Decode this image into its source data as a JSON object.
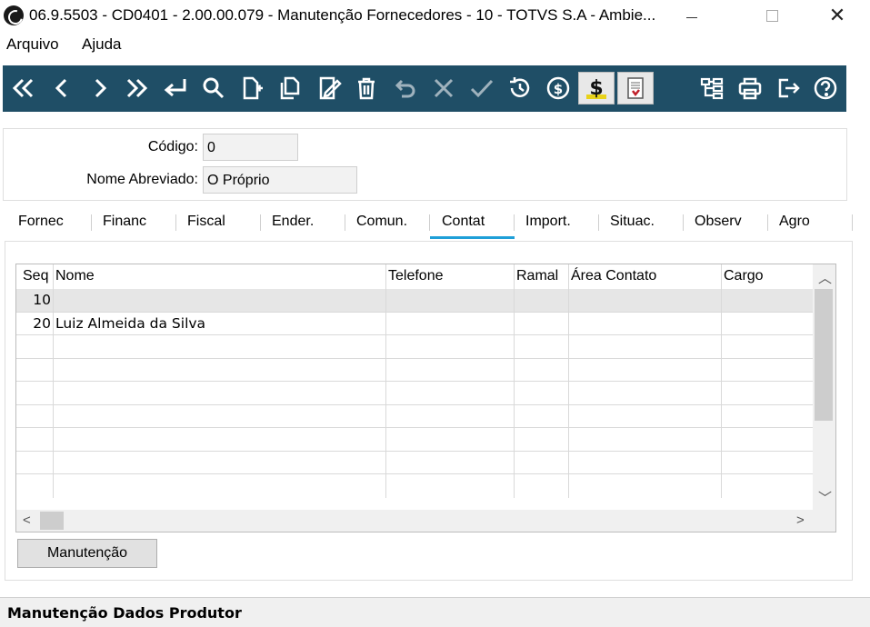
{
  "window": {
    "title": "06.9.5503 - CD0401 - 2.00.00.079 - Manutenção Fornecedores - 10 - TOTVS S.A - Ambie..."
  },
  "menu": {
    "items": [
      "Arquivo",
      "Ajuda"
    ]
  },
  "toolbar": {
    "color": "#1f4e66",
    "buttons": [
      {
        "icon": "first-record-icon"
      },
      {
        "icon": "previous-record-icon"
      },
      {
        "icon": "next-record-icon"
      },
      {
        "icon": "last-record-icon"
      },
      {
        "icon": "go-to-icon"
      },
      {
        "icon": "search-icon"
      },
      {
        "icon": "new-record-icon"
      },
      {
        "icon": "copy-record-icon"
      },
      {
        "icon": "edit-record-icon"
      },
      {
        "icon": "delete-icon"
      },
      {
        "icon": "undo-icon"
      },
      {
        "icon": "cancel-icon"
      },
      {
        "icon": "save-check-icon"
      },
      {
        "icon": "history-icon"
      },
      {
        "icon": "currency-icon"
      },
      {
        "icon": "dollar-icon"
      },
      {
        "icon": "report-icon"
      },
      {
        "icon": "tree-icon"
      },
      {
        "icon": "print-icon"
      },
      {
        "icon": "exit-icon"
      },
      {
        "icon": "help-icon"
      }
    ]
  },
  "form": {
    "codigo_label": "Código:",
    "codigo_value": "0",
    "nome_label": "Nome Abreviado:",
    "nome_value": "O Próprio"
  },
  "tabs": [
    "Fornec",
    "Financ",
    "Fiscal",
    "Ender.",
    "Comun.",
    "Contat",
    "Import.",
    "Situac.",
    "Observ",
    "Agro"
  ],
  "active_tab": "Contat",
  "grid": {
    "columns": [
      "Seq",
      "Nome",
      "Telefone",
      "Ramal",
      "Área Contato",
      "Cargo"
    ],
    "rows": [
      [
        "10",
        "",
        "",
        "",
        "",
        ""
      ],
      [
        "20",
        "Luiz Almeida da Silva",
        "",
        "",
        "",
        ""
      ]
    ]
  },
  "buttons": {
    "manutencao": "Manutenção"
  },
  "status": {
    "text": "Manutenção Dados Produtor"
  }
}
